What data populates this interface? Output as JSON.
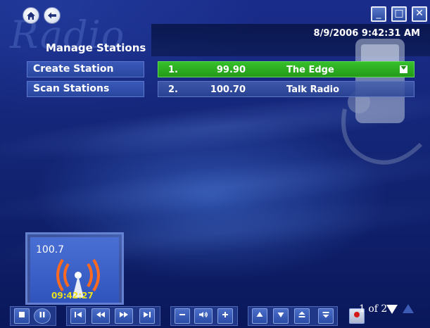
{
  "app": {
    "watermark": "Radio",
    "title": "Manage Stations",
    "datetime": "8/9/2006 9:42:31 AM"
  },
  "nav": {
    "home_icon": "home-icon",
    "back_icon": "back-arrow-icon"
  },
  "window_controls": {
    "minimize_label": "_",
    "maximize_label": "□",
    "close_label": "✕"
  },
  "menu": {
    "items": [
      {
        "label": "Create Station"
      },
      {
        "label": "Scan Stations"
      }
    ]
  },
  "stations": [
    {
      "num": "1.",
      "freq": "99.90",
      "name": "The Edge",
      "selected": true
    },
    {
      "num": "2.",
      "freq": "100.70",
      "name": "Talk Radio",
      "selected": false
    }
  ],
  "now_playing": {
    "frequency": "100.7",
    "time": "09:42:27",
    "icon": "radio-tower-icon"
  },
  "pagination": {
    "text": "1 of 2"
  },
  "transport": {
    "buttons": [
      "stop",
      "pause",
      "skip-back",
      "rewind",
      "fast-forward",
      "skip-forward",
      "volume-down",
      "mute",
      "volume-up",
      "up",
      "down",
      "page-up",
      "page-down",
      "record"
    ]
  },
  "colors": {
    "selected_row": "#2eb024",
    "time_text": "#e8e020",
    "tower_waves": "#ff6a20"
  }
}
